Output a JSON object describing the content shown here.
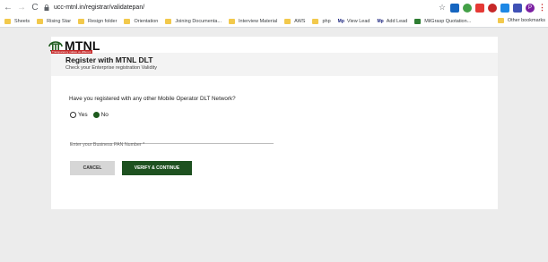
{
  "browser": {
    "url": "ucc-mtnl.in/registrar/validatepan/",
    "bookmarks": [
      {
        "label": "Sheets",
        "icon": "folder-icon"
      },
      {
        "label": "Rising Star",
        "icon": "folder-icon"
      },
      {
        "label": "Resign folder",
        "icon": "folder-icon"
      },
      {
        "label": "Orientation",
        "icon": "folder-icon"
      },
      {
        "label": "Joining Documenta...",
        "icon": "folder-icon"
      },
      {
        "label": "Interview Material",
        "icon": "folder-icon"
      },
      {
        "label": "AWS",
        "icon": "folder-icon"
      },
      {
        "label": "php",
        "icon": "folder-icon"
      },
      {
        "label": "View Lead",
        "icon": "mp-logo-icon"
      },
      {
        "label": "Add Lead",
        "icon": "mp-logo-icon"
      },
      {
        "label": "MilGrasp Quotation...",
        "icon": "sheet-icon"
      }
    ],
    "other_bookmarks": "Other bookmarks",
    "profile_initial": "P"
  },
  "page": {
    "logo_text": "MTNL",
    "tagline": "Transparency makes us different",
    "title": "Register with MTNL DLT",
    "subtitle": "Check your Enterprise registration Validity",
    "question": "Have you registered with any other Mobile Operator DLT Network?",
    "options": [
      {
        "label": "Yes",
        "selected": false
      },
      {
        "label": "No",
        "selected": true
      }
    ],
    "pan_placeholder": "Enter your Business PAN Number *",
    "cancel_label": "CANCEL",
    "verify_label": "VERIFY & CONTINUE"
  },
  "colors": {
    "brand_green": "#1e5120",
    "brand_red": "#c62828",
    "cancel_gray": "#d6d6d6"
  }
}
